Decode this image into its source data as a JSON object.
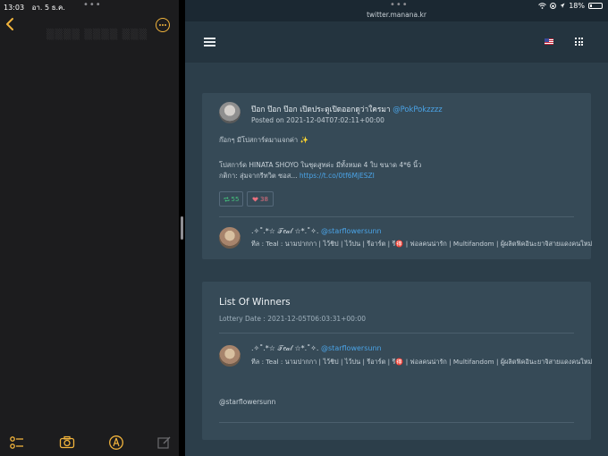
{
  "left_pane": {
    "status_time": "13:03",
    "status_date": "อา. 5 ธ.ค.",
    "multitask_dots": "•••",
    "ghost_title": "▒▒▒▒ ▒▒▒▒ ▒▒▒"
  },
  "right_pane": {
    "url": "twitter.manana.kr",
    "multitask_dots": "•••",
    "battery": "18%",
    "tweet": {
      "author_name": "ป๊อก ป๊อก ป๊อก เปิดประตูเปิดออกดูว่าใครมา",
      "author_handle": "@PokPokzzzz",
      "posted": "Posted on 2021-12-04T07:02:11+00:00",
      "line1": "ก๊อกๆ มีโปสการ์ดมาแจกค่า ✨",
      "line2": "โปสการ์ด HINATA SHOYO ในชุดสูทค่ะ มีทั้งหมด 4 ใบ ขนาด 4*6 นิ้ว",
      "line3_prefix": "กติกา: สุ่มจากรีทวิต ซอส...",
      "line3_link": "https://t.co/0tf6MjESZI",
      "retweets": "55",
      "likes": "38"
    },
    "retweeter": {
      "name": ".✧˚.*☆ 𝒯𝑒𝒶𝓁 ☆*.˚✧.",
      "handle": "@starflowersunn",
      "bio": "ทีล : Teal : นามปากกา | ไว้ชิป | ไว้บ่น | รีอาร์ต | รี🉐 | ฟอลคนน่ารัก | Multifandom | ผู้ผลิตฟิคอินะยาจิสายแดงคนใหม่"
    },
    "winners": {
      "title": "List Of Winners",
      "lottery_date": "Lottery Date : 2021-12-05T06:03:31+00:00",
      "winner_name": ".✧˚.*☆ 𝒯𝑒𝒶𝓁 ☆*.˚✧.",
      "winner_handle": "@starflowersunn",
      "winner_bio": "ทีล : Teal : นามปากกา | ไว้ชิป | ไว้บ่น | รีอาร์ต | รี🉐 | ฟอลคนน่ารัก | Multifandom | ผู้ผลิตฟิคอินะยาจิสายแดงคนใหม่",
      "winner_mention": "@starflowersunn"
    }
  },
  "colors": {
    "accent_notes": "#f2b43c",
    "link": "#4aa3e6",
    "retweet": "#45c27d",
    "like": "#e7707f"
  }
}
